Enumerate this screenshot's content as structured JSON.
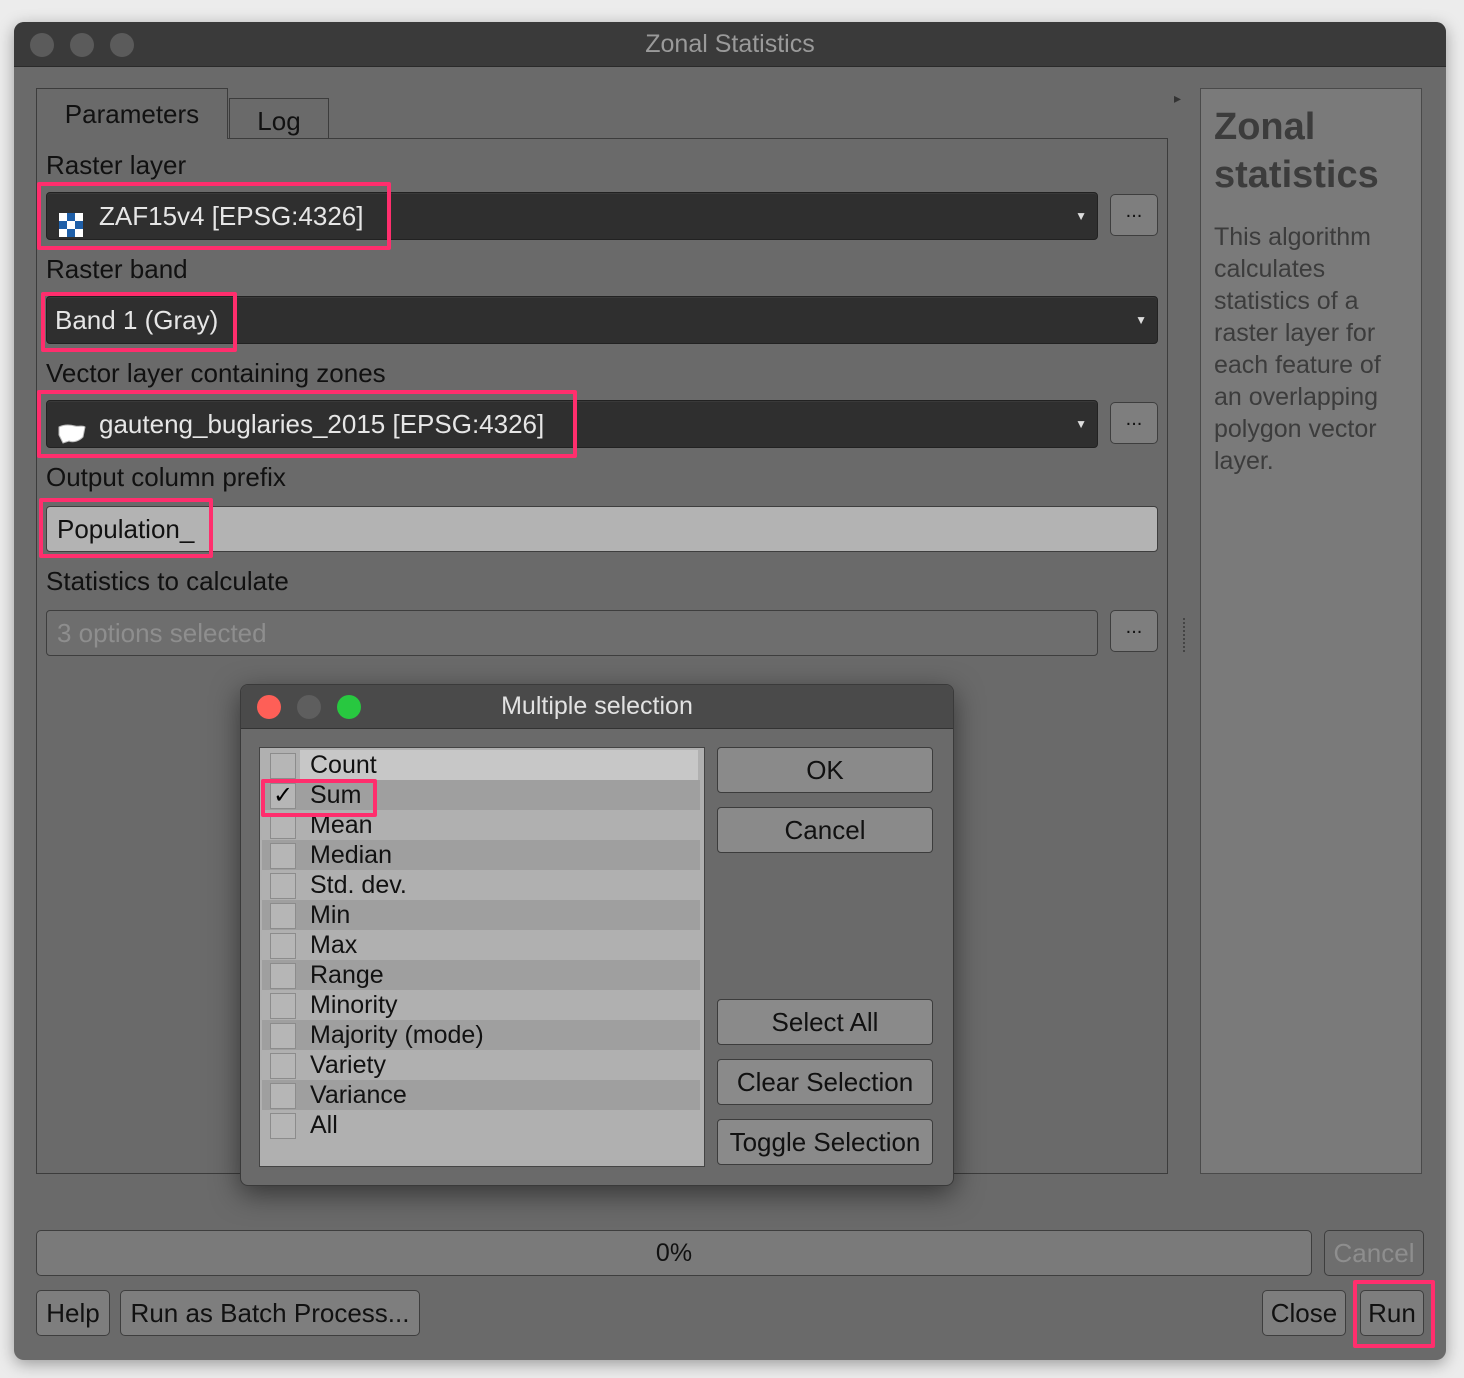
{
  "window": {
    "title": "Zonal Statistics"
  },
  "tabs": [
    {
      "label": "Parameters"
    },
    {
      "label": "Log"
    }
  ],
  "params": {
    "raster_layer": {
      "label": "Raster layer",
      "value": "ZAF15v4 [EPSG:4326]",
      "browse": "..."
    },
    "raster_band": {
      "label": "Raster band",
      "value": "Band 1 (Gray)"
    },
    "vector_layer": {
      "label": "Vector layer containing zones",
      "value": "gauteng_buglaries_2015 [EPSG:4326]",
      "browse": "..."
    },
    "output_prefix": {
      "label": "Output column prefix",
      "value": "Population_"
    },
    "statistics": {
      "label": "Statistics to calculate",
      "value": "3 options selected",
      "browse": "..."
    }
  },
  "help": {
    "title": "Zonal statistics",
    "body": "This algorithm calculates statistics of a raster layer for each feature of an overlapping polygon vector layer."
  },
  "progress": {
    "text": "0%",
    "value": 0
  },
  "buttons": {
    "cancel": "Cancel",
    "help": "Help",
    "batch": "Run as Batch Process...",
    "close": "Close",
    "run": "Run"
  },
  "dialog": {
    "title": "Multiple selection",
    "items": [
      {
        "label": "Count",
        "checked": false
      },
      {
        "label": "Sum",
        "checked": true
      },
      {
        "label": "Mean",
        "checked": false
      },
      {
        "label": "Median",
        "checked": false
      },
      {
        "label": "Std. dev.",
        "checked": false
      },
      {
        "label": "Min",
        "checked": false
      },
      {
        "label": "Max",
        "checked": false
      },
      {
        "label": "Range",
        "checked": false
      },
      {
        "label": "Minority",
        "checked": false
      },
      {
        "label": "Majority (mode)",
        "checked": false
      },
      {
        "label": "Variety",
        "checked": false
      },
      {
        "label": "Variance",
        "checked": false
      },
      {
        "label": "All",
        "checked": false
      }
    ],
    "check_mark": "✓",
    "ok": "OK",
    "cancel": "Cancel",
    "select_all": "Select All",
    "clear_selection": "Clear Selection",
    "toggle_selection": "Toggle Selection"
  },
  "colors": {
    "highlight": "#ff2e6d",
    "close": "#fe5f57",
    "minimize": "#febc2e",
    "zoom": "#28c840"
  }
}
